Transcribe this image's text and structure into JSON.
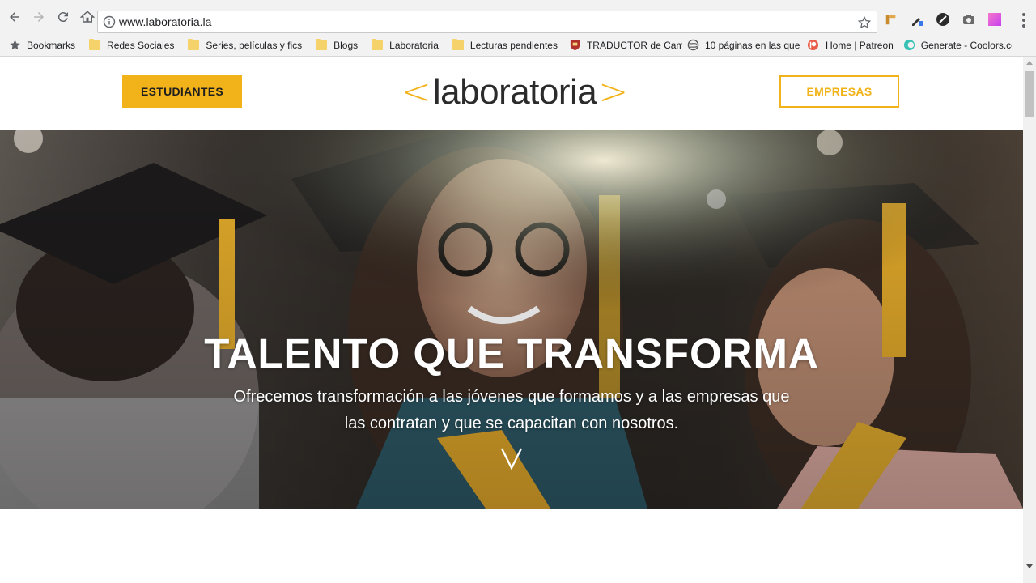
{
  "browser": {
    "url": "www.laboratoria.la",
    "bookmarks": [
      {
        "label": "Bookmarks",
        "icon": "star-icon"
      },
      {
        "label": "Redes Sociales",
        "icon": "folder-icon"
      },
      {
        "label": "Series, películas y fics",
        "icon": "folder-icon"
      },
      {
        "label": "Blogs",
        "icon": "folder-icon"
      },
      {
        "label": "Laboratoria",
        "icon": "folder-icon"
      },
      {
        "label": "Lecturas pendientes",
        "icon": "folder-icon"
      },
      {
        "label": "TRADUCTOR de Cam",
        "icon": "shield-icon"
      },
      {
        "label": "10 páginas en las que",
        "icon": "globe-icon"
      },
      {
        "label": "Home | Patreon",
        "icon": "patreon-icon"
      },
      {
        "label": "Generate - Coolors.co",
        "icon": "coolors-icon"
      }
    ]
  },
  "header": {
    "students_label": "ESTUDIANTES",
    "companies_label": "EMPRESAS",
    "logo_left": "<",
    "logo_text": "laboratoria",
    "logo_right": ">"
  },
  "hero": {
    "title": "TALENTO QUE TRANSFORMA",
    "subtitle_line1": "Ofrecemos transformación a las jóvenes que formamos y a las empresas que",
    "subtitle_line2": "las contratan y que se capacitan con nosotros.",
    "scroll_glyph": "V"
  },
  "colors": {
    "brand_yellow": "#f2b31a",
    "logo_text": "#2b2b2b",
    "chrome_bg": "#f2f2f2"
  }
}
